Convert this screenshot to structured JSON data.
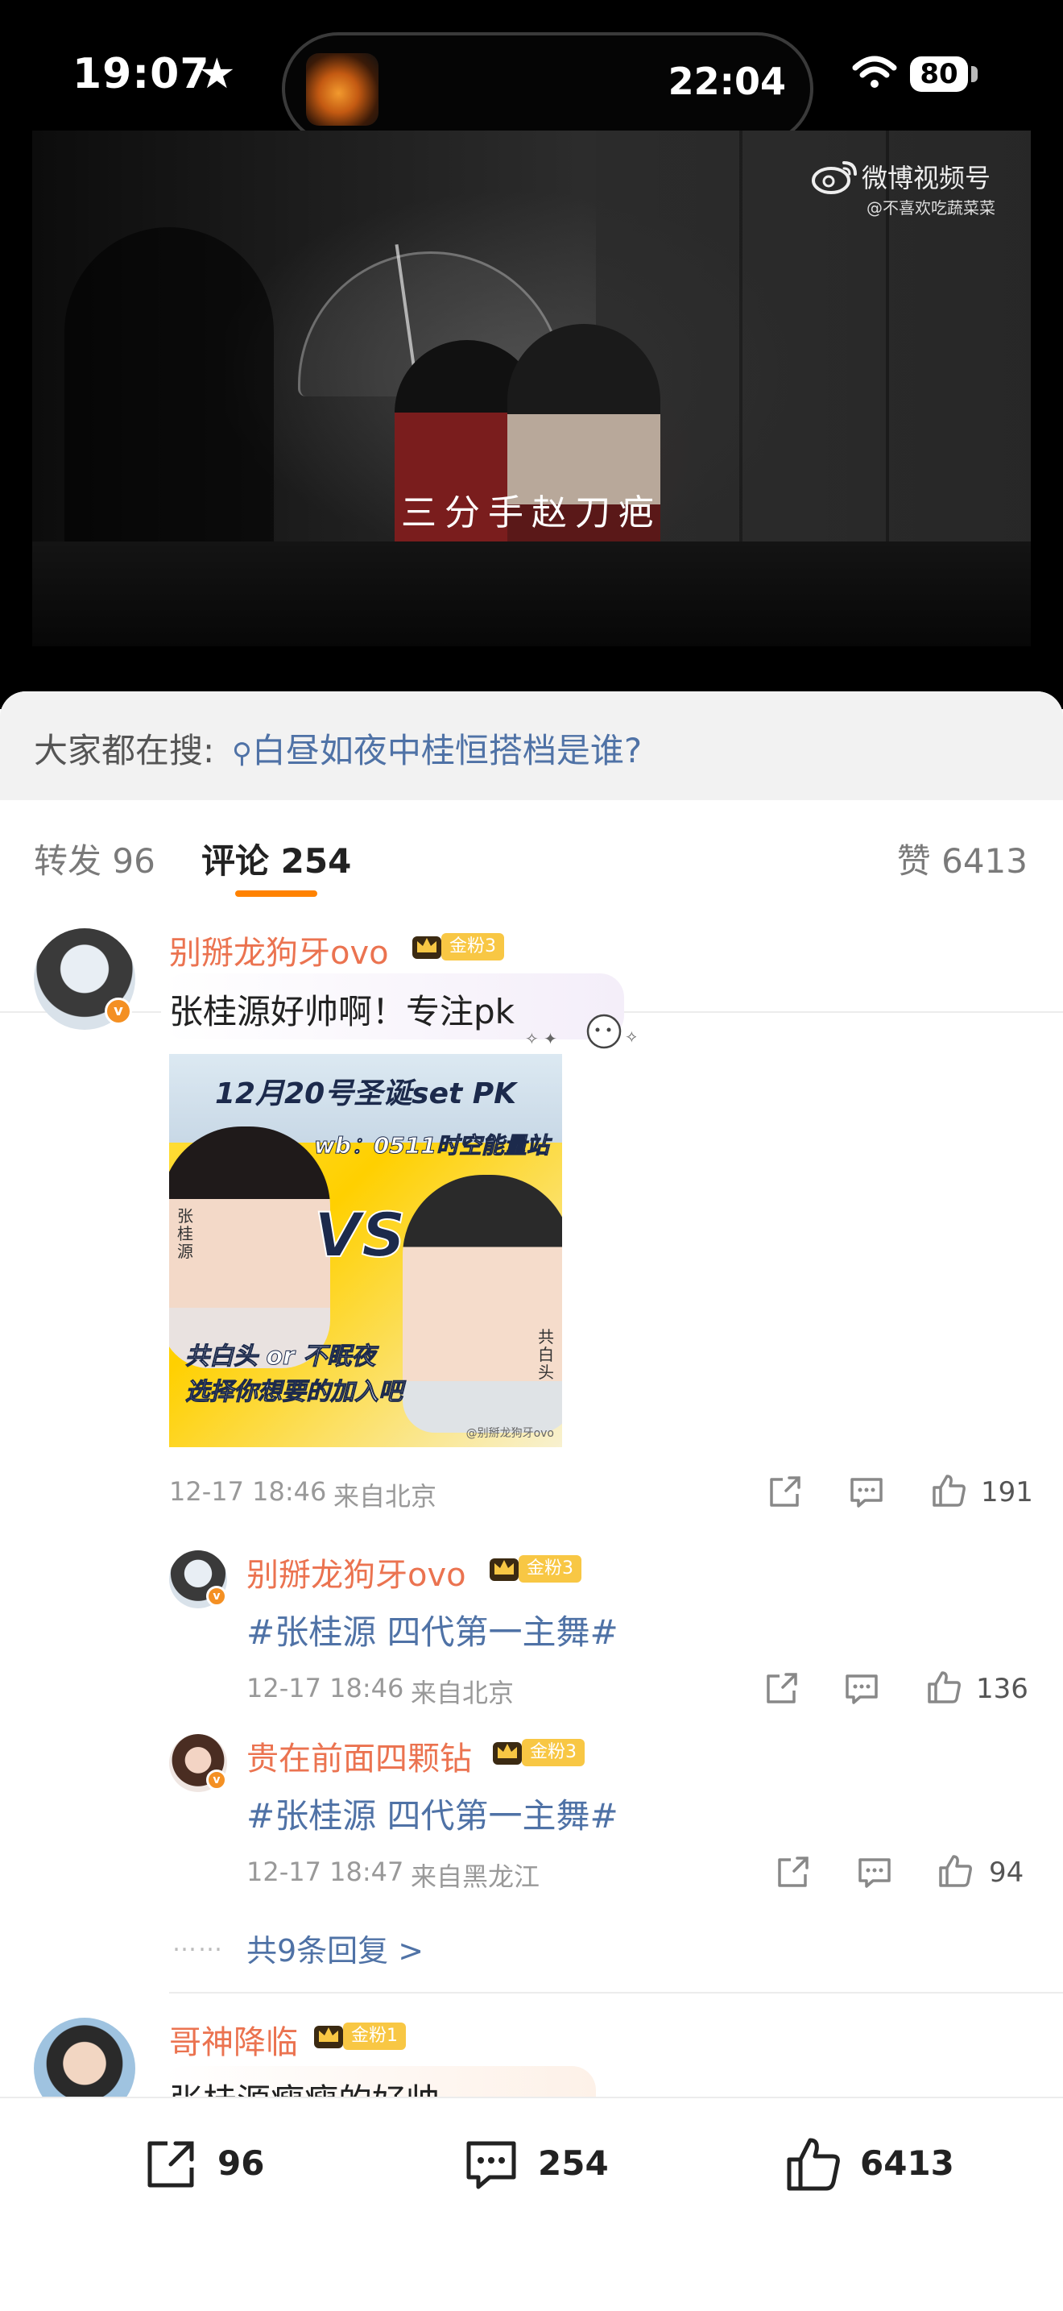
{
  "status_bar": {
    "time": "19:07",
    "island_time": "22:04",
    "battery": "80"
  },
  "video": {
    "caption": "三分手赵刀疤",
    "watermark_title": "微博视频号",
    "watermark_user": "@不喜欢吃蔬菜菜"
  },
  "search": {
    "label": "大家都在搜:",
    "query": "白昼如夜中桂恒搭档是谁?"
  },
  "tabs": {
    "repost": "转发 96",
    "comment": "评论 254",
    "like": "赞 6413"
  },
  "comments": [
    {
      "user": "别掰龙狗牙ovo",
      "fan_badge": "金粉3",
      "text": "张桂源好帅啊！专注pk",
      "image": {
        "title": "12月20号圣诞set PK",
        "wb": "wb：0511时空能量站",
        "vs": "VS",
        "line1": "共白头 or 不眠夜",
        "line2": "选择你想要的加入吧",
        "left_name": "张桂源",
        "right_name": "共白头",
        "mark": "@别掰龙狗牙ovo"
      },
      "time": "12-17 18:46",
      "location": "来自北京",
      "likes": "191"
    }
  ],
  "replies": [
    {
      "user": "别掰龙狗牙ovo",
      "fan_badge": "金粉3",
      "text": "#张桂源 四代第一主舞#",
      "time": "12-17 18:46",
      "location": "来自北京",
      "likes": "136"
    },
    {
      "user": "贵在前面四颗钻",
      "fan_badge": "金粉3",
      "text": "#张桂源 四代第一主舞#",
      "time": "12-17 18:47",
      "location": "来自黑龙江",
      "likes": "94"
    }
  ],
  "more_replies": "共9条回复 >",
  "dots": "……",
  "second_comment": {
    "user": "哥神降临",
    "fan_badge": "金粉1",
    "text": "张桂源瘦瘦的好帅"
  },
  "bottom_bar": {
    "repost_count": "96",
    "comment_count": "254",
    "like_count": "6413"
  },
  "colors": {
    "accent": "#ff8200",
    "username": "#eb7350",
    "link": "#4f72a6",
    "fan_badge": "#f8c744"
  },
  "icons": [
    "star-icon",
    "wifi-icon",
    "weibo-logo-icon",
    "search-icon",
    "crown-icon",
    "share-icon",
    "comment-icon",
    "like-icon",
    "verified-icon"
  ]
}
